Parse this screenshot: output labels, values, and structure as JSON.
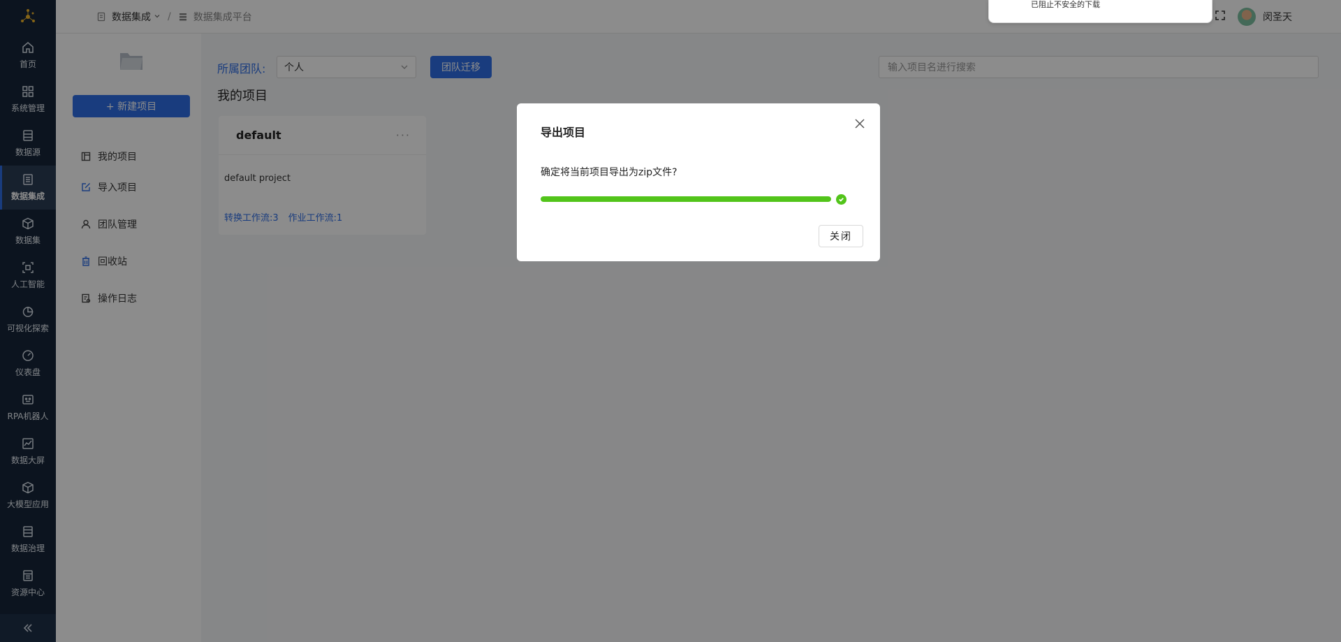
{
  "nav": {
    "items": [
      {
        "label": "首页",
        "icon": "home-icon"
      },
      {
        "label": "系统管理",
        "icon": "grid-icon"
      },
      {
        "label": "数据源",
        "icon": "database-icon"
      },
      {
        "label": "数据集成",
        "icon": "integration-icon",
        "active": true
      },
      {
        "label": "数据集",
        "icon": "cube-icon"
      },
      {
        "label": "人工智能",
        "icon": "ai-icon"
      },
      {
        "label": "可视化探索",
        "icon": "pie-chart-icon"
      },
      {
        "label": "仪表盘",
        "icon": "gauge-icon"
      },
      {
        "label": "RPA机器人",
        "icon": "robot-icon"
      },
      {
        "label": "数据大屏",
        "icon": "line-chart-icon"
      },
      {
        "label": "大模型应用",
        "icon": "model-cube-icon"
      },
      {
        "label": "数据治理",
        "icon": "governance-icon"
      },
      {
        "label": "资源中心",
        "icon": "resource-icon"
      }
    ]
  },
  "header": {
    "breadcrumb_root": "数据集成",
    "breadcrumb_sep": "/",
    "breadcrumb_current": "数据集成平台",
    "user_name": "闵圣天",
    "download_notice": "已阻止不安全的下载"
  },
  "sidebar": {
    "new_project": "+ 新建项目",
    "menu": [
      "我的项目",
      "导入项目",
      "团队管理",
      "回收站",
      "操作日志"
    ]
  },
  "main": {
    "team_label": "所属团队:",
    "team_value": "个人",
    "migrate_btn": "团队迁移",
    "search_placeholder": "输入项目名进行搜索",
    "section_title": "我的项目",
    "card": {
      "name": "default",
      "more": "···",
      "description": "default project",
      "transform_flows": "转换工作流:3",
      "job_flows": "作业工作流:1"
    }
  },
  "modal": {
    "title": "导出项目",
    "message": "确定将当前项目导出为zip文件?",
    "progress": 1.0,
    "close_btn": "关闭"
  },
  "colors": {
    "nav_bg": "#16263a",
    "primary": "#2f6de5",
    "success": "#52c41a"
  }
}
